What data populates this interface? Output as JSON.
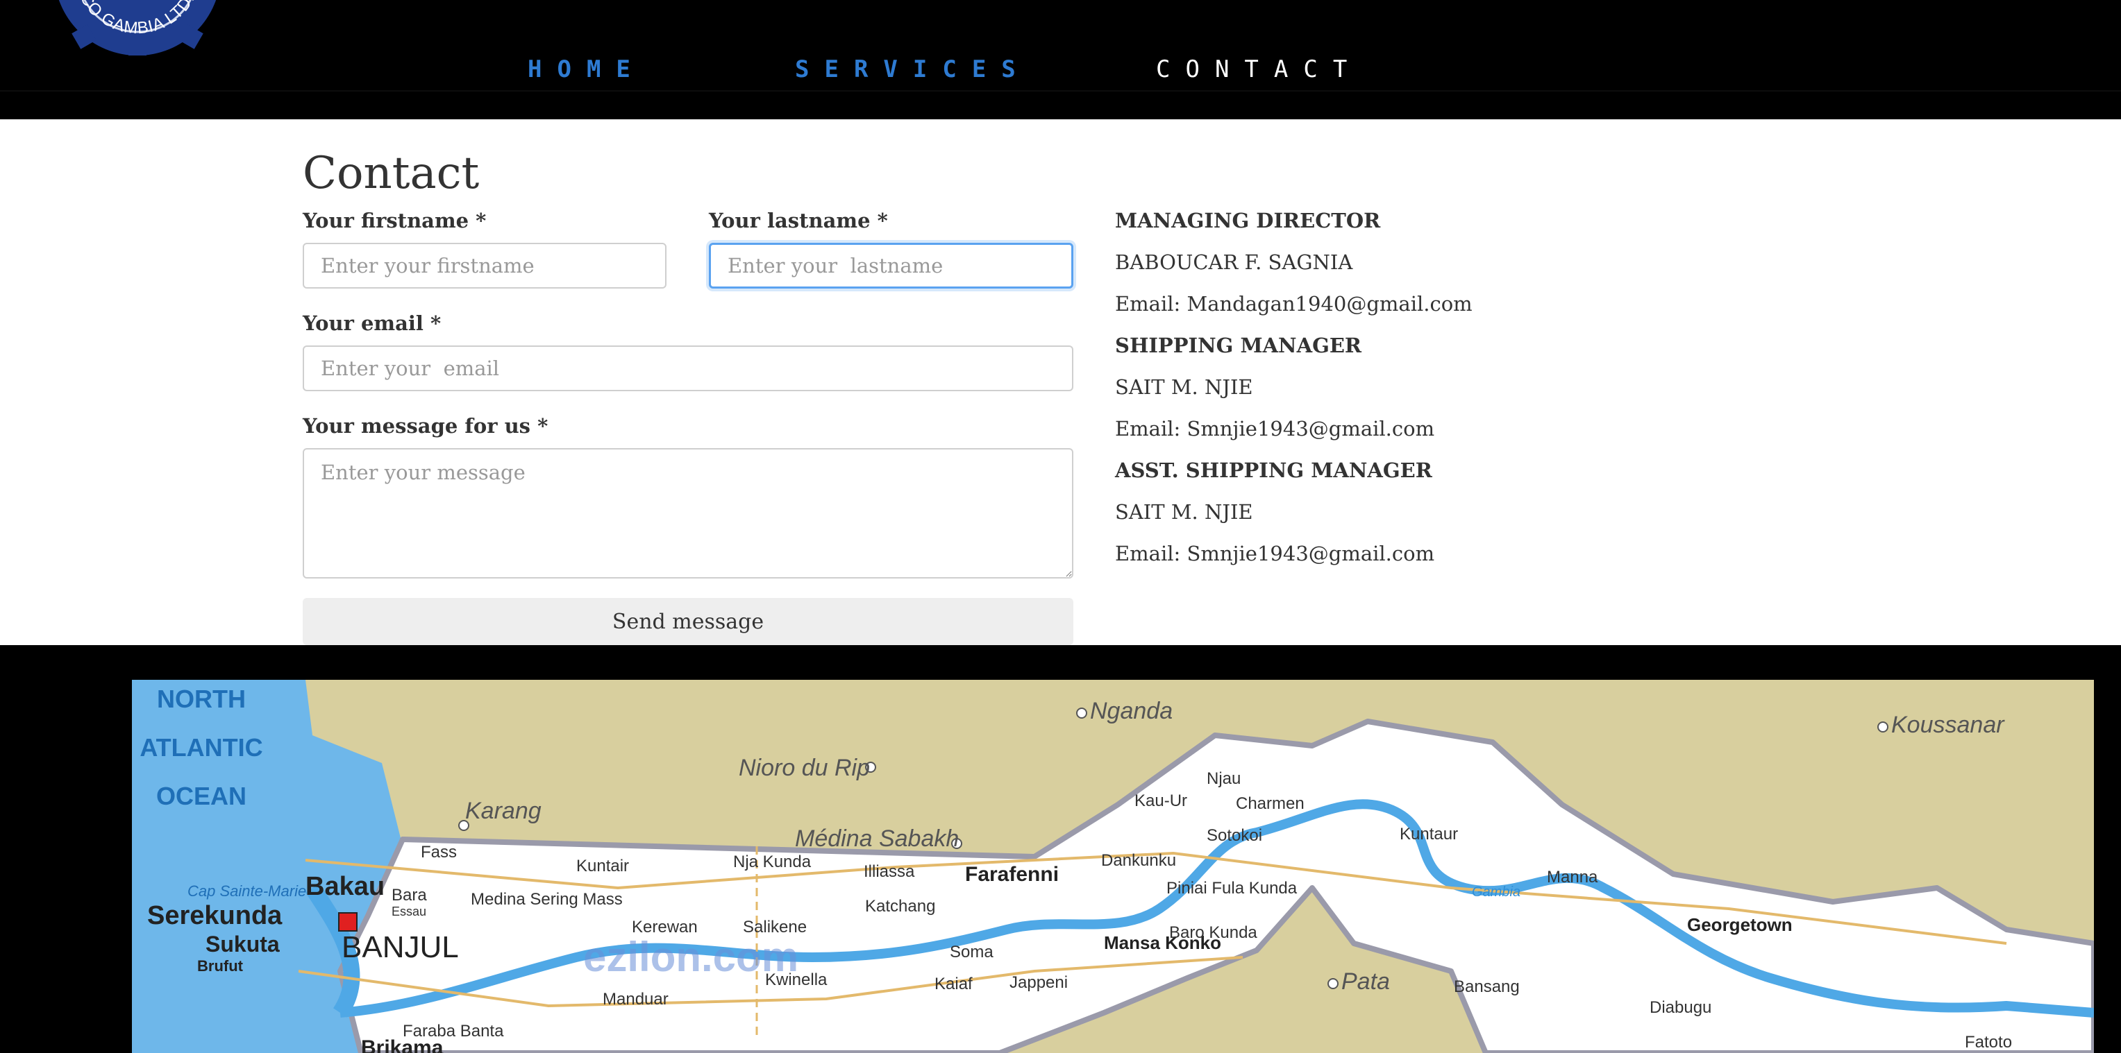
{
  "logo": {
    "text": "CO GAMBIA LTD."
  },
  "nav": {
    "home": "HOME",
    "services": "SERVICES",
    "contact": "CONTACT"
  },
  "contact": {
    "title": "Contact",
    "firstname_label": "Your firstname *",
    "firstname_placeholder": "Enter your firstname",
    "lastname_label": "Your lastname *",
    "lastname_placeholder": "Enter your  lastname",
    "email_label": "Your email *",
    "email_placeholder": "Enter your  email",
    "message_label": "Your message for us *",
    "message_placeholder": "Enter your message",
    "send_label": "Send message"
  },
  "staff": [
    {
      "role": "MANAGING DIRECTOR",
      "name": "BABOUCAR F. SAGNIA",
      "email": "Email: Mandagan1940@gmail.com"
    },
    {
      "role": "SHIPPING MANAGER",
      "name": "SAIT M. NJIE",
      "email": "Email: Smnjie1943@gmail.com"
    },
    {
      "role": "ASST. SHIPPING MANAGER",
      "name": "SAIT M. NJIE",
      "email": "Email: Smnjie1943@gmail.com"
    }
  ],
  "map": {
    "ocean": [
      "NORTH",
      "ATLANTIC",
      "OCEAN"
    ],
    "watermark": "ezilon.com",
    "places": {
      "nganda": "Nganda",
      "koussanar": "Koussanar",
      "nioro": "Nioro du Rip",
      "karang": "Karang",
      "medina_sabakh": "Médina Sabakh",
      "cap": "Cap Sainte-Marie",
      "bakau": "Bakau",
      "serekunda": "Serekunda",
      "sukuta": "Sukuta",
      "brufut": "Brufut",
      "banjul": "BANJUL",
      "fass": "Fass",
      "bara": "Bara",
      "essau": "Essau",
      "medina_sering": "Medina\nSering Mass",
      "kuntair": "Kuntair",
      "kerewan": "Kerewan",
      "salikene": "Salikene",
      "nja_kunda": "Nja Kunda",
      "illiassa": "Illiassa",
      "katchang": "Katchang",
      "farafenni": "Farafenni",
      "soma": "Soma",
      "mansa_konko": "Mansa Konko",
      "kwinella": "Kwinella",
      "kaiaf": "Kaiaf",
      "jappeni": "Jappeni",
      "manduar": "Manduar",
      "dankunku": "Dankunku",
      "kau_ur": "Kau-Ur",
      "njau": "Njau",
      "charmen": "Charmen",
      "sotokoi": "Sotokoi",
      "kuntaur": "Kuntaur",
      "piniai": "Piniai Fula Kunda",
      "baro_kunda": "Baro Kunda",
      "manna": "Manna",
      "georgetown": "Georgetown",
      "pata": "Pata",
      "bansang": "Bansang",
      "diabugu": "Diabugu",
      "fatoto": "Fatoto",
      "barra_banta": "Faraba Banta",
      "brikama": "Brikama",
      "gambia": "Gambia"
    }
  }
}
